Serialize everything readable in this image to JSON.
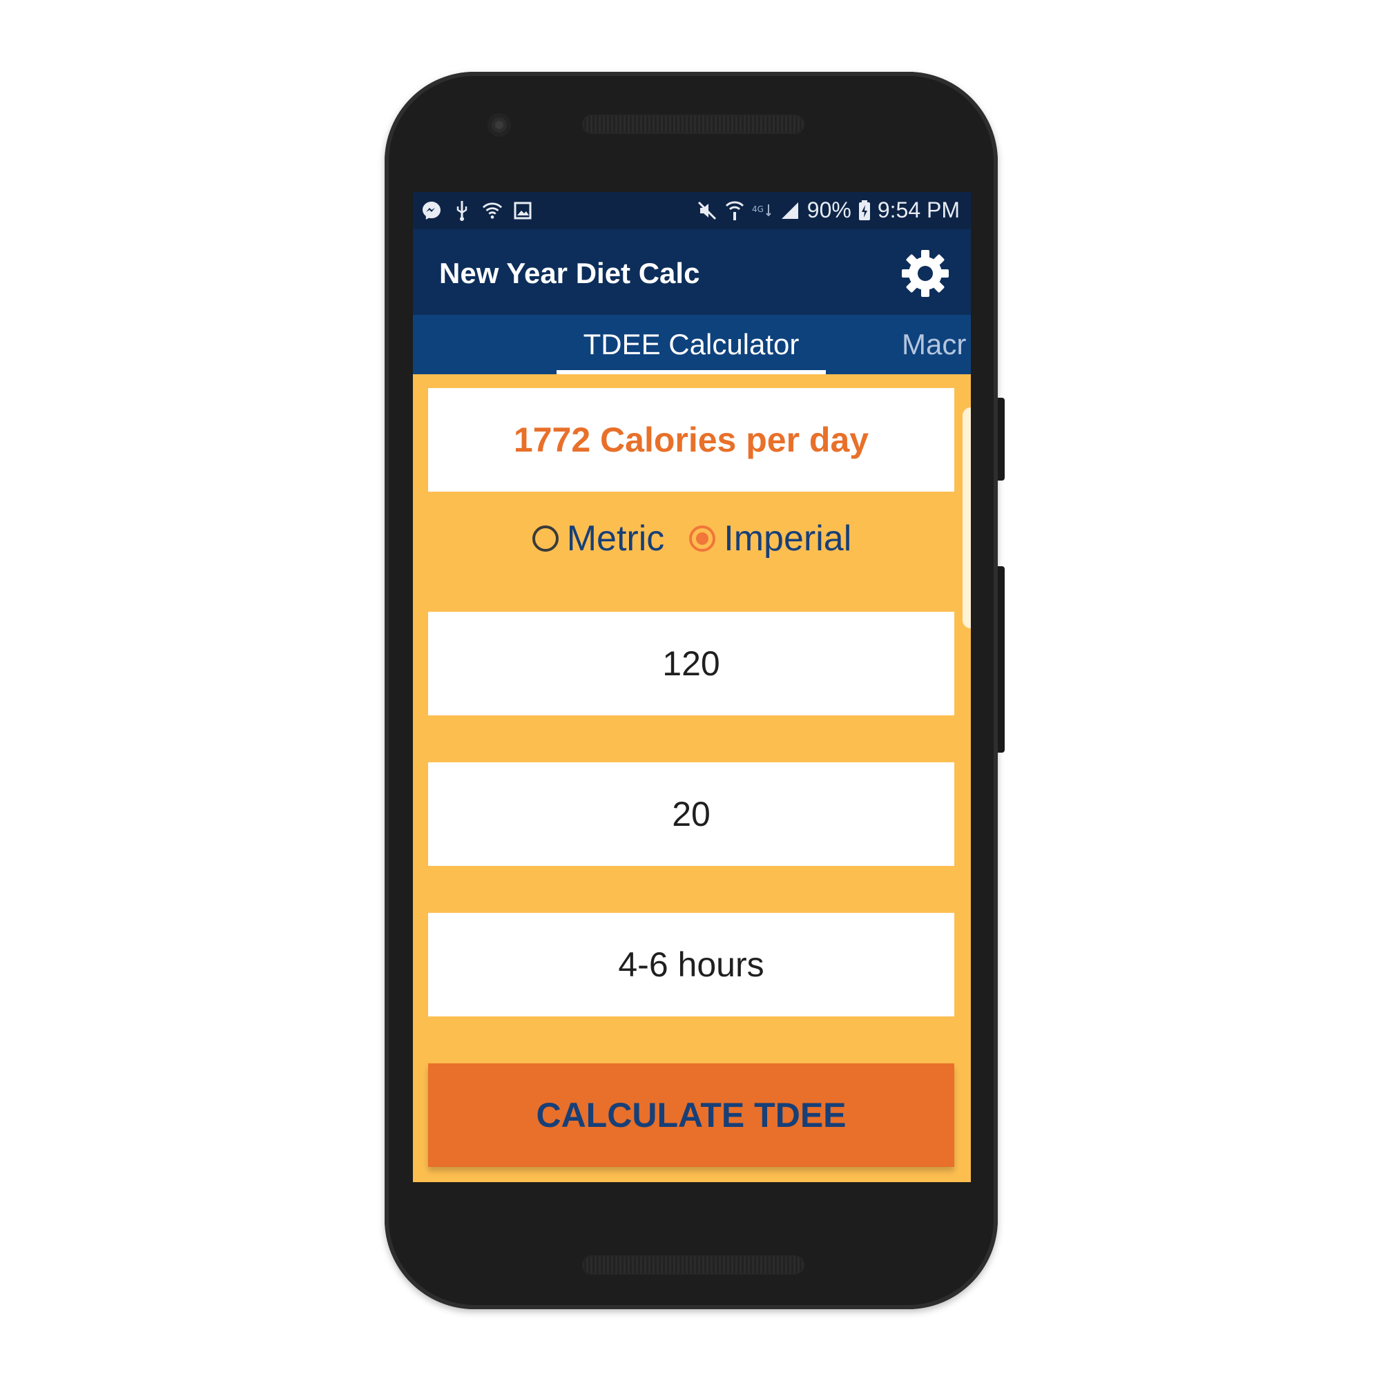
{
  "status_bar": {
    "left_icons": [
      "messenger-icon",
      "usb-icon",
      "wifi-icon",
      "image-icon"
    ],
    "battery": "90%",
    "time": "9:54 PM"
  },
  "app_bar": {
    "title": "New Year Diet Calc"
  },
  "tabs": [
    {
      "label": "TDEE Calculator",
      "active": true
    },
    {
      "label": "Macr",
      "active": false
    }
  ],
  "result": {
    "text": "1772 Calories per day"
  },
  "units": {
    "options": [
      {
        "label": "Metric",
        "selected": false
      },
      {
        "label": "Imperial",
        "selected": true
      }
    ]
  },
  "fields": {
    "weight_value": "120",
    "age_value": "20",
    "exercise_value": "4-6 hours"
  },
  "calculate_button": {
    "label": "CALCULATE TDEE"
  },
  "colors": {
    "status_bar": "#0d2447",
    "app_bar": "#0d2e5a",
    "tab_bar": "#0e427d",
    "background": "#FDBE50",
    "accent_orange": "#E8702A",
    "text_blue": "#173f78"
  }
}
